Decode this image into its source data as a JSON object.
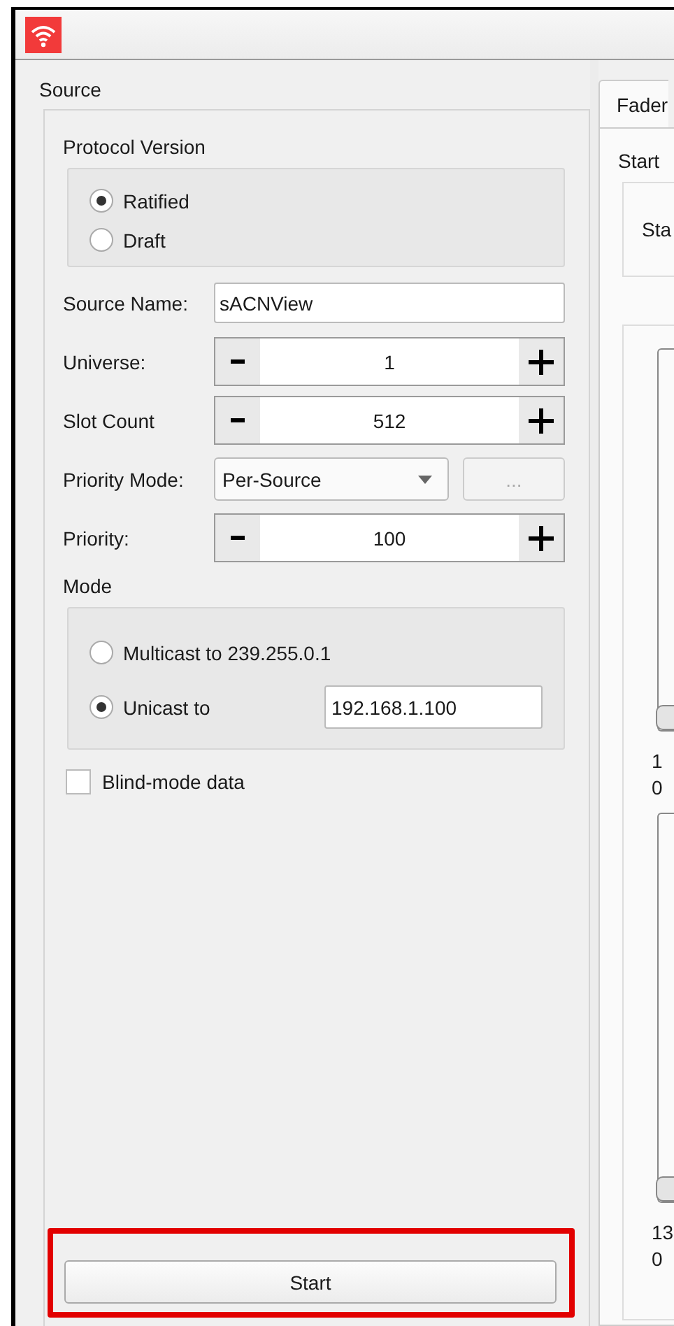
{
  "source": {
    "title": "Source",
    "protocol": {
      "title": "Protocol Version",
      "options": [
        {
          "label": "Ratified",
          "selected": true
        },
        {
          "label": "Draft",
          "selected": false
        }
      ]
    },
    "fields": [
      {
        "kind": "text",
        "label": "Source Name:",
        "value": "sACNView"
      },
      {
        "kind": "spin",
        "label": "Universe:",
        "value": "1"
      },
      {
        "kind": "spin",
        "label": "Slot Count",
        "value": "512"
      },
      {
        "kind": "combo",
        "label": "Priority Mode:",
        "value": "Per-Source",
        "button": "...",
        "button_disabled": true
      },
      {
        "kind": "spin",
        "label": "Priority:",
        "value": "100"
      }
    ],
    "mode": {
      "title": "Mode",
      "options": [
        {
          "label": "Multicast to 239.255.0.1",
          "selected": false
        },
        {
          "label": "Unicast to",
          "selected": true,
          "value": "192.168.1.100"
        }
      ]
    },
    "blind": {
      "label": "Blind-mode data",
      "checked": false
    },
    "start": {
      "label": "Start",
      "highlighted": true
    }
  },
  "right": {
    "tab": {
      "label": "Fader",
      "selected": true
    },
    "start_group": {
      "title": "Start",
      "button": "Sta"
    },
    "faders": [
      {
        "level": 0,
        "labels": [
          "1",
          "0"
        ]
      },
      {
        "level": 0,
        "labels": [
          "13",
          "0"
        ]
      }
    ]
  }
}
